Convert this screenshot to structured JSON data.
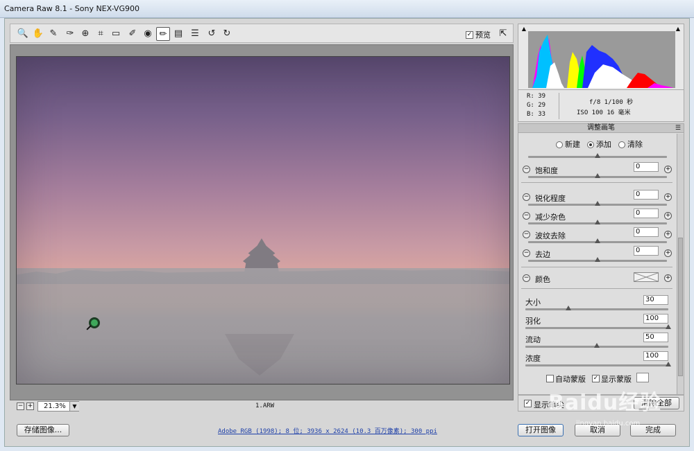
{
  "window": {
    "title": "Camera Raw 8.1 -  Sony NEX-VG900"
  },
  "toolbar": {
    "tools": [
      {
        "name": "zoom-tool",
        "glyph": "🔍"
      },
      {
        "name": "hand-tool",
        "glyph": "✋"
      },
      {
        "name": "white-balance-tool",
        "glyph": "✎"
      },
      {
        "name": "color-sampler-tool",
        "glyph": "✑"
      },
      {
        "name": "target-adjust-tool",
        "glyph": "⊕"
      },
      {
        "name": "crop-tool",
        "glyph": "⌗"
      },
      {
        "name": "straighten-tool",
        "glyph": "▭"
      },
      {
        "name": "spot-removal-tool",
        "glyph": "✐"
      },
      {
        "name": "red-eye-tool",
        "glyph": "◉"
      },
      {
        "name": "adjustment-brush-tool",
        "glyph": "✏"
      },
      {
        "name": "graduated-filter-tool",
        "glyph": "▤"
      },
      {
        "name": "preferences-tool",
        "glyph": "☰"
      },
      {
        "name": "rotate-ccw-tool",
        "glyph": "↺"
      },
      {
        "name": "rotate-cw-tool",
        "glyph": "↻"
      }
    ],
    "preview_label": "预览",
    "preview_checked": true
  },
  "canvas": {
    "zoom_value": "21.3%",
    "filename": "1.ARW"
  },
  "info": {
    "r_label": "R:",
    "r_value": "39",
    "g_label": "G:",
    "g_value": "29",
    "b_label": "B:",
    "b_value": "33",
    "exif_line1": "f/8   1/100 秒",
    "exif_line2": "ISO 100   16 毫米"
  },
  "panel": {
    "title": "调整画笔",
    "modes": [
      "新建",
      "添加",
      "清除"
    ],
    "selected_mode": "添加",
    "sliders_top": [
      {
        "label": "饱和度",
        "value": "0",
        "position": 0.5
      },
      {
        "label": "锐化程度",
        "value": "0",
        "position": 0.5
      },
      {
        "label": "减少杂色",
        "value": "0",
        "position": 0.5
      },
      {
        "label": "波纹去除",
        "value": "0",
        "position": 0.5
      },
      {
        "label": "去边",
        "value": "0",
        "position": 0.5
      }
    ],
    "color_label": "颜色",
    "brush": [
      {
        "label": "大小",
        "value": "30",
        "position": 0.3
      },
      {
        "label": "羽化",
        "value": "100",
        "position": 1.0
      },
      {
        "label": "流动",
        "value": "50",
        "position": 0.5
      },
      {
        "label": "浓度",
        "value": "100",
        "position": 1.0
      }
    ],
    "auto_mask_label": "自动蒙版",
    "auto_mask_checked": false,
    "show_mask_label": "显示蒙版",
    "show_mask_checked": true,
    "overlay_label": "显示笔尖",
    "overlay_checked": true,
    "clear_all_label": "清除全部"
  },
  "bottom": {
    "save_label": "存储图像...",
    "workflow_text": "Adobe RGB (1998); 8 位; 3936 x 2624 (10.3 百万像素); 300 ppi",
    "open_label": "打开图像",
    "cancel_label": "取消",
    "done_label": "完成"
  },
  "watermark": {
    "text": "Baidu经验",
    "sub": "jingyan.baidu.com"
  },
  "colors": {
    "accent": "#3a6fb0",
    "panel_bg": "#dedede"
  }
}
